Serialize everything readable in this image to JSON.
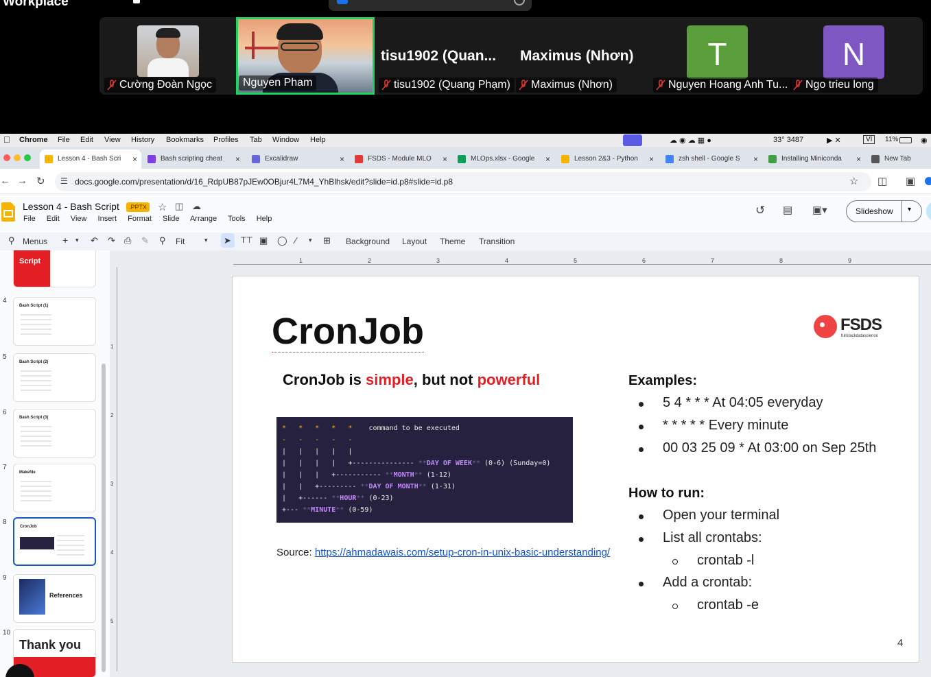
{
  "zoom": {
    "workplace_label": "Workplace",
    "participants": [
      {
        "name": "Cường Đoàn Ngọc"
      },
      {
        "name": "Nguyen Pham"
      },
      {
        "name": "tisu1902 (Quang Phạm)",
        "big": "tisu1902  (Quan..."
      },
      {
        "name": "Maximus (Nhơn)",
        "big": "Maximus (Nhơn)"
      },
      {
        "name": "Nguyen Hoang Anh Tu...",
        "initial": "T",
        "color": "#5a9e3b"
      },
      {
        "name": "Ngo trieu long",
        "initial": "N",
        "color": "#7e57c2"
      }
    ]
  },
  "menubar": {
    "items": [
      "Chrome",
      "File",
      "Edit",
      "View",
      "History",
      "Bookmarks",
      "Profiles",
      "Tab",
      "Window",
      "Help"
    ],
    "status_temp": "33° 3487",
    "status_vi": "VI",
    "battery": "11%"
  },
  "tabs": [
    {
      "title": "Lesson 4 - Bash Scri",
      "color": "#f4b400"
    },
    {
      "title": "Bash scripting cheat",
      "color": "#7b3fe4"
    },
    {
      "title": "Excalidraw",
      "color": "#6965db"
    },
    {
      "title": "FSDS - Module MLO",
      "color": "#e53935"
    },
    {
      "title": "MLOps.xlsx - Google",
      "color": "#0f9d58"
    },
    {
      "title": "Lesson 2&3 - Python",
      "color": "#f4b400"
    },
    {
      "title": "zsh shell - Google S",
      "color": "#4285f4"
    },
    {
      "title": "Installing Miniconda",
      "color": "#43a047"
    },
    {
      "title": "New Tab",
      "color": "#555555"
    }
  ],
  "address": {
    "url": "docs.google.com/presentation/d/16_RdpUB87pJEw0OBjur4L7M4_YhBlhsk/edit?slide=id.p8#slide=id.p8"
  },
  "doc": {
    "title": "Lesson 4 - Bash Script",
    "badge": ".PPTX",
    "menus": [
      "File",
      "Edit",
      "View",
      "Insert",
      "Format",
      "Slide",
      "Arrange",
      "Tools",
      "Help"
    ],
    "slideshow": "Slideshow"
  },
  "toolbar": {
    "menus": "Menus",
    "zoom": "Fit",
    "background": "Background",
    "layout": "Layout",
    "theme": "Theme",
    "transition": "Transition"
  },
  "film": {
    "top_script": "Script",
    "slides": [
      {
        "num": "4",
        "title": "Bash Script (1)"
      },
      {
        "num": "5",
        "title": "Bash Script (2)"
      },
      {
        "num": "6",
        "title": "Bash Script (3)"
      },
      {
        "num": "7",
        "title": "Makefile"
      },
      {
        "num": "8",
        "title": "CronJob"
      },
      {
        "num": "9",
        "title": "References"
      },
      {
        "num": "10",
        "title": "Thank you"
      }
    ]
  },
  "ruler": {
    "h": [
      "1",
      "2",
      "3",
      "4",
      "5",
      "6",
      "7",
      "8",
      "9"
    ],
    "v": [
      "1",
      "2",
      "3",
      "4",
      "5"
    ]
  },
  "slide": {
    "title": "CronJob",
    "logo": "FSDS",
    "logo_sub": "fullstackdatascience",
    "subtitle_a": "CronJob is ",
    "subtitle_b": "simple",
    "subtitle_c": ", but not ",
    "subtitle_d": "powerful",
    "source_label": "Source: ",
    "source_link": "https://ahmadawais.com/setup-cron-in-unix-basic-understanding/",
    "examples_title": "Examples:",
    "examples": [
      "5 4 * * * At 04:05 everyday",
      "* * * * * Every minute",
      "00 03 25 09 * At 03:00 on Sep 25th"
    ],
    "howto_title": "How to run:",
    "howto": [
      "Open your terminal",
      "List all crontabs:",
      "crontab -l",
      "Add a crontab:",
      "crontab -e"
    ],
    "page_num": "4"
  },
  "code_lines": [
    "*   *   *   *   *    command to be executed",
    "-   -   -   -   -",
    "|   |   |   |   |",
    "|   |   |   |   +--------------- **DAY OF WEEK** (0-6) (Sunday=0)",
    "|   |   |   +----------- **MONTH** (1-12)",
    "|   |   +--------- **DAY OF MONTH** (1-31)",
    "|   +------ **HOUR** (0-23)",
    "+--- **MINUTE** (0-59)"
  ]
}
